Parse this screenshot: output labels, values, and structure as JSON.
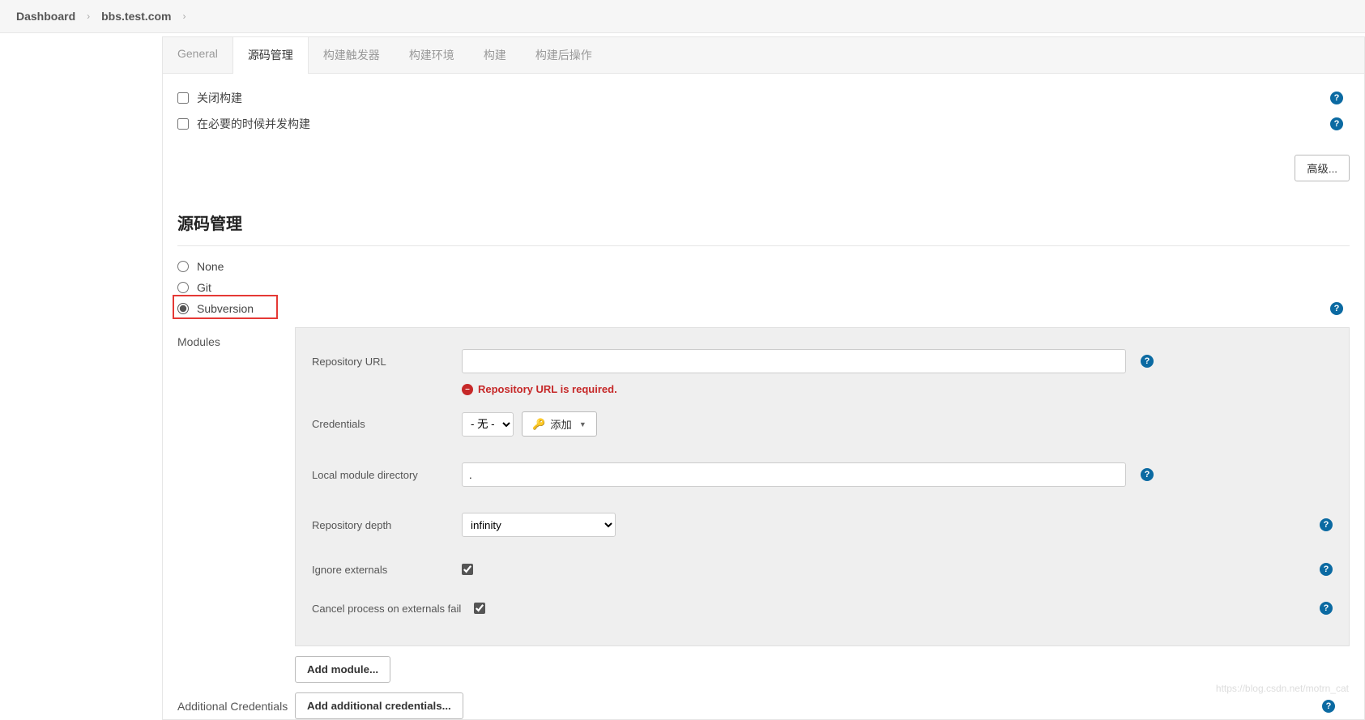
{
  "breadcrumb": {
    "items": [
      "Dashboard",
      "bbs.test.com"
    ]
  },
  "tabs": [
    "General",
    "源码管理",
    "构建触发器",
    "构建环境",
    "构建",
    "构建后操作"
  ],
  "activeTab": 1,
  "topChecks": {
    "disableBuild": "关闭构建",
    "concurrentBuild": "在必要的时候并发构建"
  },
  "advancedBtn": "高级...",
  "scm": {
    "title": "源码管理",
    "options": {
      "none": "None",
      "git": "Git",
      "svn": "Subversion"
    }
  },
  "modules": {
    "sideLabel": "Modules",
    "repoUrl": {
      "label": "Repository URL",
      "value": "",
      "error": "Repository URL is required."
    },
    "credentials": {
      "label": "Credentials",
      "noneOption": "- 无 -",
      "addBtn": "添加"
    },
    "localDir": {
      "label": "Local module directory",
      "value": "."
    },
    "depth": {
      "label": "Repository depth",
      "value": "infinity"
    },
    "ignoreExternals": {
      "label": "Ignore externals",
      "checked": true
    },
    "cancelOnFail": {
      "label": "Cancel process on externals fail",
      "checked": true
    },
    "addModuleBtn": "Add module..."
  },
  "additionalCreds": {
    "label": "Additional Credentials",
    "btn": "Add additional credentials..."
  },
  "watermark": "https://blog.csdn.net/motrn_cat"
}
